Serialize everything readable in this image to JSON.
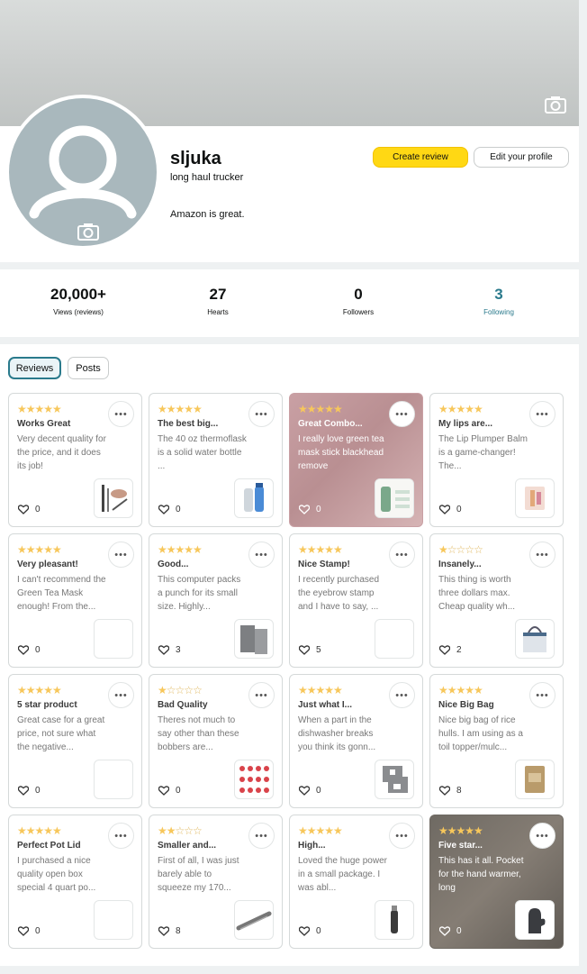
{
  "profile": {
    "name": "sljuka",
    "subtitle": "long haul trucker",
    "bio": "Amazon is great.",
    "create_review_label": "Create review",
    "edit_profile_label": "Edit your profile"
  },
  "stats": [
    {
      "value": "20,000+",
      "label": "Views (reviews)"
    },
    {
      "value": "27",
      "label": "Hearts"
    },
    {
      "value": "0",
      "label": "Followers"
    },
    {
      "value": "3",
      "label": "Following"
    }
  ],
  "tabs": [
    {
      "label": "Reviews",
      "active": true
    },
    {
      "label": "Posts",
      "active": false
    }
  ],
  "colors": {
    "accent": "#2a7a8c",
    "primary_button": "#ffd814",
    "star": "#f7c75b"
  },
  "reviews": [
    {
      "stars": 5,
      "title": "Works Great",
      "body": "Very decent quality for the price, and it does its job!",
      "likes": "0",
      "thumb": "makeup-brush"
    },
    {
      "stars": 5,
      "title": "The best big...",
      "body": "The 40 oz thermoflask is a solid water bottle ...",
      "likes": "0",
      "thumb": "water-bottles"
    },
    {
      "stars": 5,
      "title": "Great Combo...",
      "body": "I really love green tea mask stick blackhead remove",
      "likes": "0",
      "thumb": "tea-mask"
    },
    {
      "stars": 5,
      "title": "My lips are...",
      "body": "The Lip Plumper Balm is a game-changer! The...",
      "likes": "0",
      "thumb": "lip-balm"
    },
    {
      "stars": 5,
      "title": "Very pleasant!",
      "body": "I can't recommend the Green Tea Mask enough! From the...",
      "likes": "0",
      "thumb": "blank"
    },
    {
      "stars": 5,
      "title": "Good...",
      "body": "This computer packs a punch for its small size. Highly...",
      "likes": "3",
      "thumb": "computer"
    },
    {
      "stars": 5,
      "title": "Nice Stamp!",
      "body": "I recently purchased the eyebrow stamp and I have to say, ...",
      "likes": "5",
      "thumb": "blank"
    },
    {
      "stars": 1,
      "title": "Insanely...",
      "body": "This thing is worth three dollars max. Cheap quality wh...",
      "likes": "2",
      "thumb": "tote-bag"
    },
    {
      "stars": 5,
      "title": "5 star product",
      "body": "Great case for a great price, not sure what the negative...",
      "likes": "0",
      "thumb": "blank"
    },
    {
      "stars": 1,
      "title": "Bad Quality",
      "body": "Theres not much to say other than these bobbers are...",
      "likes": "0",
      "thumb": "bobbers"
    },
    {
      "stars": 5,
      "title": "Just what I...",
      "body": "When a part in the dishwasher breaks you think its gonn...",
      "likes": "0",
      "thumb": "dishwasher-part"
    },
    {
      "stars": 5,
      "title": "Nice Big Bag",
      "body": "Nice big bag of rice hulls. I am using as a toil topper/mulc...",
      "likes": "8",
      "thumb": "rice-bag"
    },
    {
      "stars": 5,
      "title": "Perfect Pot Lid",
      "body": "I purchased a nice quality open box special 4 quart po...",
      "likes": "0",
      "thumb": "blank"
    },
    {
      "stars": 2,
      "title": "Smaller and...",
      "body": "First of all, I was just barely able to squeeze my 170...",
      "likes": "8",
      "thumb": "cable"
    },
    {
      "stars": 5,
      "title": "High...",
      "body": "Loved the huge power in a small package. I was abl...",
      "likes": "0",
      "thumb": "trimmer"
    },
    {
      "stars": 5,
      "title": "Five star...",
      "body": "This has it all. Pocket for the hand warmer, long",
      "likes": "0",
      "thumb": "glove"
    }
  ]
}
